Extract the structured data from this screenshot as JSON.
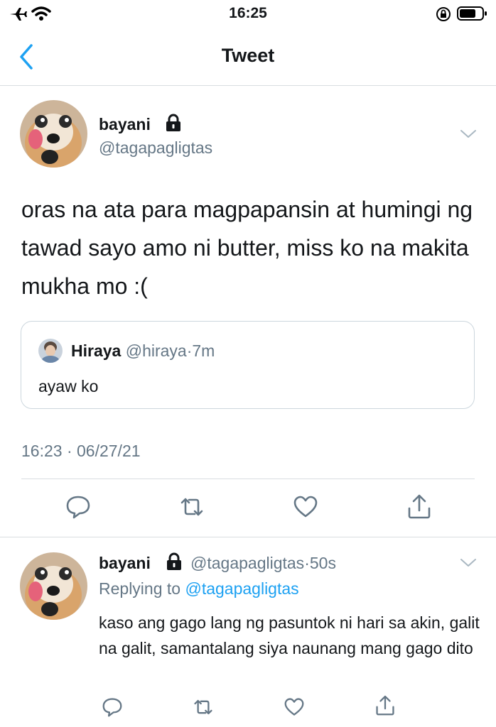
{
  "status_bar": {
    "time": "16:25"
  },
  "nav": {
    "title": "Tweet"
  },
  "tweet": {
    "author_name": "bayani",
    "author_handle": "@tagapagligtas",
    "text": "oras na ata para magpapansin at humingi ng tawad sayo amo ni butter, miss ko na makita mukha mo :(",
    "quote": {
      "name": "Hiraya",
      "handle": "@hiraya",
      "separator": "·",
      "time": "7m",
      "text": "ayaw ko"
    },
    "timestamp": "16:23 · 06/27/21"
  },
  "reply": {
    "author_name": "bayani",
    "author_handle": "@tagapagligtas",
    "separator": "·",
    "time": "50s",
    "replying_prefix": "Replying to",
    "replying_to": "@tagapagligtas",
    "text": "kaso ang gago lang ng pasuntok ni hari sa akin, galit na galit, samantalang siya naunang mang gago dito"
  },
  "colors": {
    "accent": "#1da1f2",
    "icon_gray": "#657786",
    "back_arrow": "#1da1f2"
  },
  "icons": [
    "airplane-icon",
    "wifi-icon",
    "rotation-lock-icon",
    "battery-icon",
    "back-chevron-icon",
    "lock-icon",
    "chevron-down-icon",
    "reply-icon",
    "retweet-icon",
    "like-icon",
    "share-icon"
  ]
}
